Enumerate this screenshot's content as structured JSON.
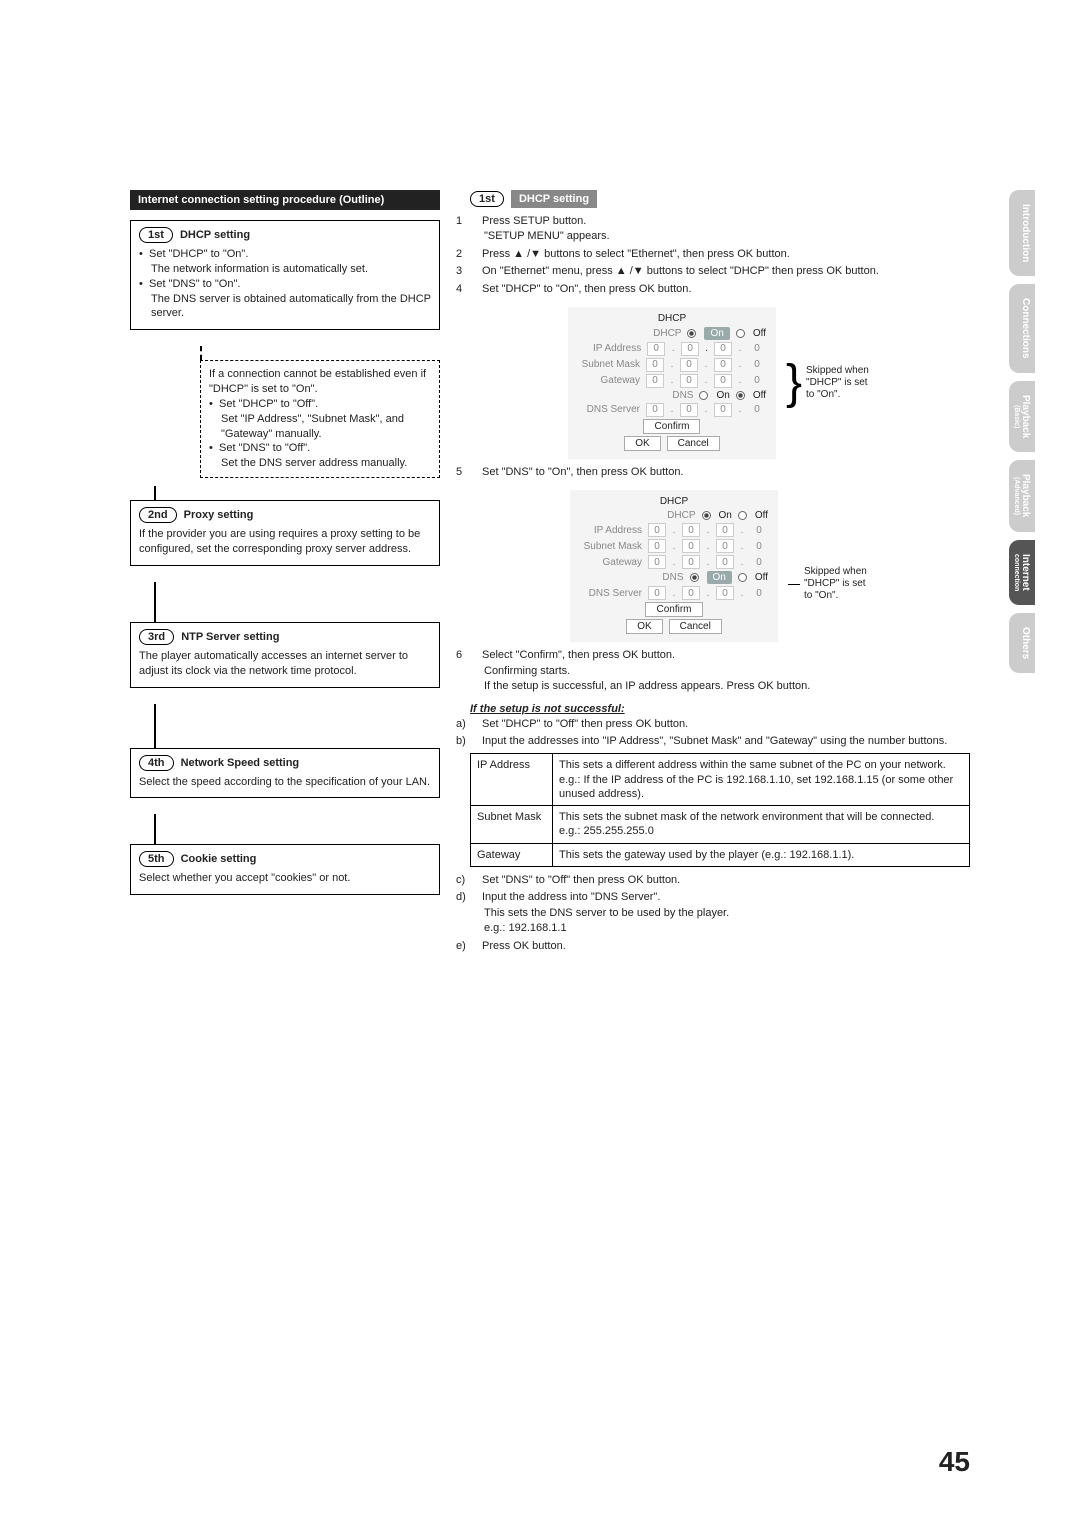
{
  "page_number": "45",
  "side_tabs": {
    "intro": "Introduction",
    "conn": "Connections",
    "play_basic": "Playback",
    "play_basic_sub": "(Basic)",
    "play_adv": "Playback",
    "play_adv_sub": "(Advanced)",
    "internet": "Internet",
    "internet_sub": "connection",
    "others": "Others"
  },
  "left": {
    "banner": "Internet connection setting procedure (Outline)",
    "step1": {
      "badge": "1st",
      "title": "DHCP setting",
      "b1": "Set \"DHCP\" to \"On\".",
      "b1_note": "The network information is automatically set.",
      "b2": "Set \"DNS\" to \"On\".",
      "b2_note": "The DNS server is obtained automatically from the DHCP server."
    },
    "dashed": {
      "l1": "If a connection cannot be established even if \"DHCP\" is set to \"On\".",
      "b1": "Set \"DHCP\" to \"Off\".",
      "b1_note": "Set \"IP Address\", \"Subnet Mask\", and \"Gateway\" manually.",
      "b2": "Set \"DNS\" to \"Off\".",
      "b2_note": "Set the DNS server address manually."
    },
    "step2": {
      "badge": "2nd",
      "title": "Proxy setting",
      "body": "If the provider you are using requires a proxy setting to be configured, set the corresponding proxy server address."
    },
    "step3": {
      "badge": "3rd",
      "title": "NTP Server setting",
      "body": "The player automatically accesses an internet server to adjust its clock via the network time protocol."
    },
    "step4": {
      "badge": "4th",
      "title": "Network Speed setting",
      "body": "Select the speed according to the specification of your LAN."
    },
    "step5": {
      "badge": "5th",
      "title": "Cookie setting",
      "body": "Select whether you accept \"cookies\" or not."
    }
  },
  "right": {
    "step_badge": "1st",
    "step_banner": "DHCP setting",
    "s1": "Press SETUP button.",
    "s1b": "\"SETUP MENU\" appears.",
    "s2": "Press ▲ /▼ buttons to select \"Ethernet\", then press OK button.",
    "s3": "On \"Ethernet\" menu, press ▲ /▼ buttons to select \"DHCP\" then press OK button.",
    "s4": "Set \"DHCP\" to \"On\", then press OK button.",
    "s5": "Set \"DNS\" to \"On\", then press OK button.",
    "s6a": "Select \"Confirm\", then press OK button.",
    "s6b": "Confirming starts.",
    "s6c": "If the setup is successful, an IP address appears. Press OK button.",
    "unsuccessful_hd": "If the setup is not successful:",
    "ua": "Set \"DHCP\" to \"Off\" then press OK button.",
    "ub": "Input the addresses into \"IP Address\", \"Subnet Mask\" and \"Gateway\" using the number buttons.",
    "uc": "Set \"DNS\" to \"Off\" then press OK button.",
    "ud": "Input the address into \"DNS Server\".",
    "ud2": "This sets the DNS server to be used by the player.",
    "ud3": "e.g.: 192.168.1.1",
    "ue": "Press OK button.",
    "panel": {
      "title": "DHCP",
      "dhcp": "DHCP",
      "on": "On",
      "off": "Off",
      "ip": "IP Address",
      "mask": "Subnet Mask",
      "gw": "Gateway",
      "dns": "DNS",
      "dnss": "DNS Server",
      "confirm": "Confirm",
      "ok": "OK",
      "cancel": "Cancel",
      "zero": "0"
    },
    "skip_note": "Skipped when \"DHCP\" is set to \"On\".",
    "def_table": {
      "ip_k": "IP Address",
      "ip_v": "This sets a different address within the same subnet of the PC on your network.\ne.g.: If the IP address of the PC is 192.168.1.10, set 192.168.1.15 (or some other unused address).",
      "mask_k": "Subnet Mask",
      "mask_v": "This sets the subnet mask of the network environment that will be connected.\ne.g.: 255.255.255.0",
      "gw_k": "Gateway",
      "gw_v": "This sets the gateway used by the player (e.g.: 192.168.1.1)."
    }
  }
}
